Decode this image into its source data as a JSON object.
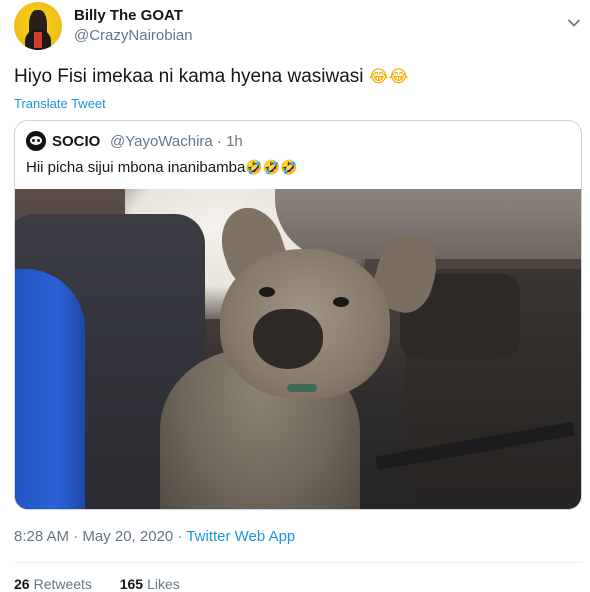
{
  "tweet": {
    "author": {
      "name": "Billy The GOAT",
      "handle": "@CrazyNairobian"
    },
    "text": "Hiyo Fisi imekaa ni kama hyena wasiwasi",
    "text_emoji": "😂😂",
    "translate_label": "Translate Tweet",
    "timestamp": "8:28 AM · May 20, 2020 · ",
    "source": "Twitter Web App",
    "retweets_count": "26",
    "retweets_label": "Retweets",
    "likes_count": "165",
    "likes_label": "Likes"
  },
  "quoted": {
    "author": {
      "name": "SOCIO",
      "handle": "@YayoWachira · 1h"
    },
    "text": "Hii picha sijui mbona inanibamba",
    "text_emoji": "🤣🤣🤣"
  },
  "icons": {
    "menu": "chevron-down-icon"
  }
}
